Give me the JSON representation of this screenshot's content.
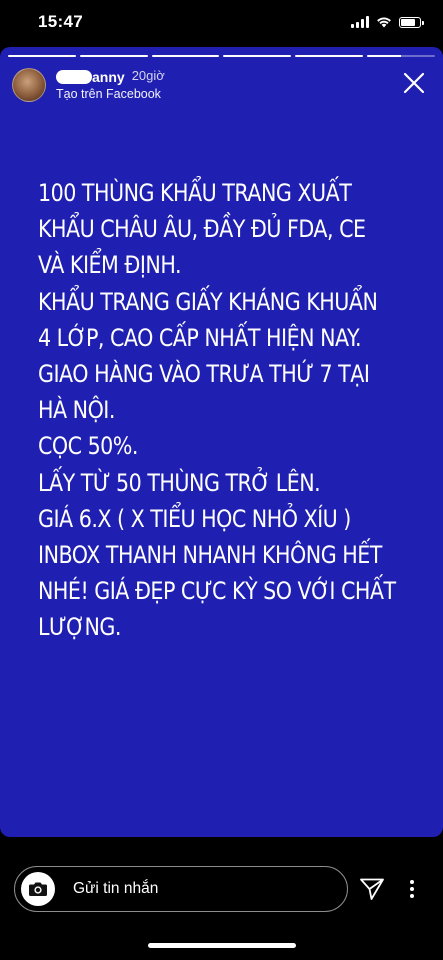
{
  "status_bar": {
    "time": "15:47",
    "icons": [
      "signal-icon",
      "wifi-icon",
      "battery-icon"
    ]
  },
  "story": {
    "background_color": "#1f1fb2",
    "progress_segments": [
      1,
      1,
      1,
      1,
      1,
      0.5
    ],
    "author": {
      "name_visible": "anny",
      "age": "20giờ",
      "source": "Tạo trên Facebook"
    },
    "lines": [
      "100 THÙNG KHẨU TRANG XUẤT",
      "KHẨU CHÂU ÂU, ĐẦY ĐỦ FDA, CE",
      "VÀ KIỂM ĐỊNH.",
      "KHẨU TRANG GIẤY KHÁNG KHUẨN",
      "4 LỚP, CAO CẤP NHẤT HIỆN NAY.",
      "GIAO HÀNG VÀO TRƯA THỨ 7 TẠI",
      "HÀ NỘI.",
      "CỌC 50%.",
      "LẤY TỪ 50 THÙNG TRỞ LÊN.",
      "GIÁ 6.X ( X TIỂU HỌC NHỎ XÍU )",
      "INBOX THANH NHANH KHÔNG HẾT",
      "NHÉ! GIÁ ĐẸP CỰC KỲ SO VỚI CHẤT",
      "LƯỢNG."
    ]
  },
  "reply": {
    "placeholder": "Gửi tin nhắn"
  }
}
